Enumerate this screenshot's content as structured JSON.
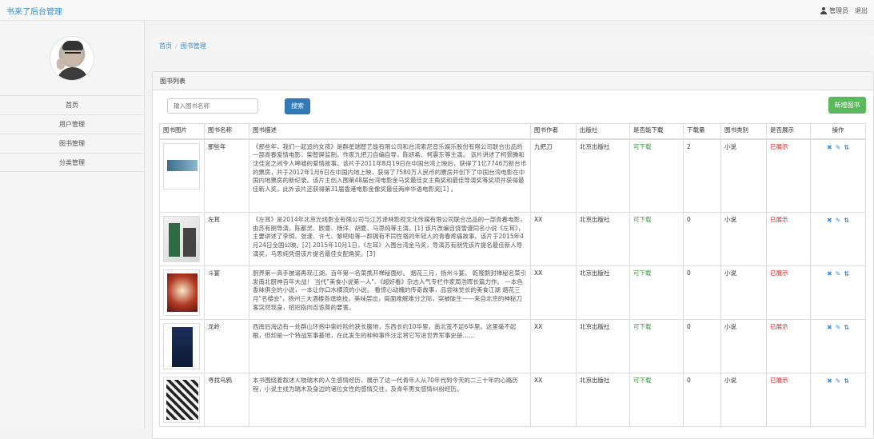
{
  "header": {
    "brand": "书来了后台管理",
    "admin_label": "管理员",
    "logout_label": "退出"
  },
  "sidebar": {
    "items": [
      {
        "label": "首页"
      },
      {
        "label": "用户管理"
      },
      {
        "label": "图书管理"
      },
      {
        "label": "分类管理"
      }
    ]
  },
  "breadcrumb": {
    "home": "首页",
    "separator": "/",
    "current": "图书管理"
  },
  "panel": {
    "title": "图书列表",
    "search_placeholder": "输入图书名称",
    "search_button": "搜索",
    "add_button": "新增图书"
  },
  "table": {
    "headers": [
      "图书图片",
      "图书名称",
      "图书描述",
      "图书作者",
      "出版社",
      "是否能下载",
      "下载量",
      "图书类别",
      "是否展示",
      "操作"
    ],
    "rows": [
      {
        "cover": "book-cover-1",
        "name": "那些年",
        "desc": "《那些年，我们一起追的女孩》是群星瑞智艺能有限公司和台湾索尼音乐娱乐股份有限公司联合出品的一部青春爱情电影，柴智屏监制，作家九把刀自编自导，陈妍希、柯震东等主演。 该片讲述了柯景腾和沈佳宜之间令人唏嘘的爱情故事。该片于2011年8月19日在中国台湾上映后，获得了1亿7746万新台币的票房，并于2012年1月6日在中国内地上映，获得了7580万人民币的票房并创下了中国台湾电影在中国内地票房的新纪录。该片主创入围第48届台湾电影金马奖最佳女主角奖和最佳导演奖等奖项并获得最佳新人奖，此外该片还获得第31届香港电影金像奖最佳两岸华语电影奖[1] 。",
        "author": "九把刀",
        "publisher": "北京出版社",
        "downloadable": "可下载",
        "downloads": "2",
        "category": "小说",
        "display": "已展示"
      },
      {
        "cover": "book-cover-2",
        "name": "左耳",
        "desc": "《左耳》是2014年北京光线影业有限公司与江苏译林影视文化传媒有限公司联合出品的一部青春电影，由苏有朋导演，陈都灵、欧豪、杨洋、胡夏、马思纯等主演。[1] 该片改编自饶雪漫同名小说《左耳》，主要讲述了李珥、张漾、许弋、黎吧啦等一群拥有不同性格的年轻人的青春疼痛故事。该片于2015年4月24日全国公映。[2] 2015年10月1日，《左耳》入围台湾金马奖，导演苏有朋凭该片提名最佳新人导演奖，马思纯凭借该片提名最佳女配角奖。[3]",
        "author": "XX",
        "publisher": "北京出版社",
        "downloadable": "可下载",
        "downloads": "0",
        "category": "小说",
        "display": "已展示"
      },
      {
        "cover": "book-cover-3",
        "name": "斗宴",
        "desc": "厨界第一高手被逼再现江湖，百年第一名菜携开禅秘面纱。 烟花三月，扬州斗宴。 乾隆鹅封禅秘名菜引发南北厨神百年大战！ 当代\"美食小说第一人\"、《超好看》杂志人气专栏作家周浩晖长篇力作。 一本色香味俱全的小说，一本让你口水横流的小说。 看惊心动魄的传奇故事，品尝味觉长的美食江湖 烟花三月\"名楼会\"，扬州三大酒楼各逞绝技，美味层出，局面难解难分之际，突被陡生——来自北京的神秘刀客突然现身，招招指向百诡莫的要害。",
        "author": "XX",
        "publisher": "北京出版社",
        "downloadable": "可下载",
        "downloads": "0",
        "category": "小说",
        "display": "已展示"
      },
      {
        "cover": "book-cover-4",
        "name": "龙岭",
        "desc": "西南后海边有一处群山环抱中崇岭险的狭长腹地，东西长约10华里，南北宽不足6华里。这里毫不起眼，但却是一个特战军事基地，在此发生的种种事件注定将它写进世界军事史册……",
        "author": "XX",
        "publisher": "北京出版社",
        "downloadable": "可下载",
        "downloads": "0",
        "category": "小说",
        "display": "已展示"
      },
      {
        "cover": "book-cover-5",
        "name": "寻找乌鸦",
        "desc": "本书围绕着叙述人物瑞木的人生感情经历，展示了这一代青年人从70年代到今天的二三十年的心路历程，小说主线为瑞木及身边的诸位女性的感情交往，及青年男女感情纠纷经历。",
        "author": "XX",
        "publisher": "北京出版社",
        "downloadable": "可下载",
        "downloads": "0",
        "category": "小说",
        "display": "已展示"
      }
    ]
  },
  "colors": {
    "brand": "#3b8fc7",
    "primary_button": "#337ab7",
    "success_button": "#5cb85c",
    "downloadable": "#3c9a3c",
    "displayed": "#e02222",
    "action_icons": "#3a8ddb"
  },
  "icons": [
    "user-icon",
    "delete-icon",
    "edit-icon",
    "sort-icon"
  ]
}
